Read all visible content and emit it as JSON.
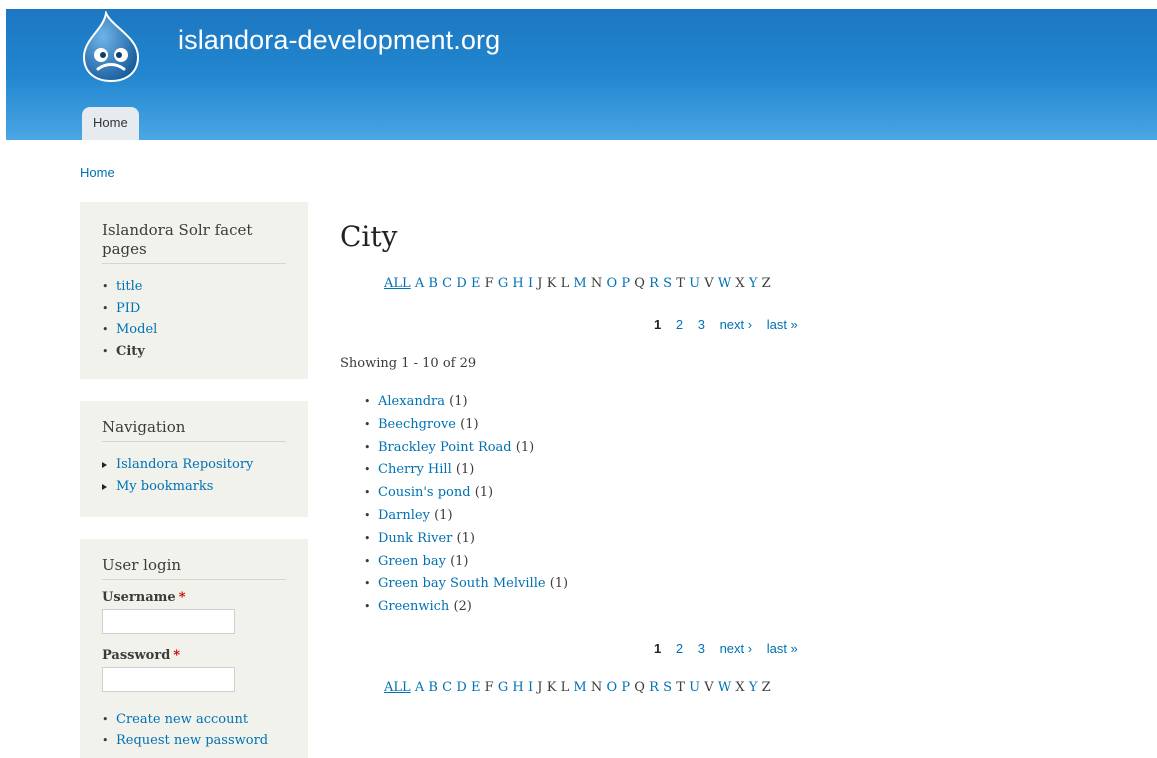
{
  "header": {
    "site_name": "islandora-development.org",
    "menu": [
      {
        "label": "Home"
      }
    ]
  },
  "breadcrumb": {
    "home": "Home"
  },
  "sidebar": {
    "facets": {
      "title": "Islandora Solr facet pages",
      "items": [
        {
          "label": "title"
        },
        {
          "label": "PID"
        },
        {
          "label": "Model"
        },
        {
          "label": "City"
        }
      ]
    },
    "navigation": {
      "title": "Navigation",
      "items": [
        {
          "label": "Islandora Repository"
        },
        {
          "label": "My bookmarks"
        }
      ]
    },
    "login": {
      "title": "User login",
      "username_label": "Username",
      "password_label": "Password",
      "required_mark": "*",
      "links": [
        {
          "label": "Create new account"
        },
        {
          "label": "Request new password"
        }
      ]
    }
  },
  "main": {
    "title": "City",
    "alphabet": [
      {
        "label": "ALL",
        "link": true
      },
      {
        "label": "A",
        "link": true
      },
      {
        "label": "B",
        "link": true
      },
      {
        "label": "C",
        "link": true
      },
      {
        "label": "D",
        "link": true
      },
      {
        "label": "E",
        "link": true
      },
      {
        "label": "F",
        "link": false
      },
      {
        "label": "G",
        "link": true
      },
      {
        "label": "H",
        "link": true
      },
      {
        "label": "I",
        "link": true
      },
      {
        "label": "J",
        "link": false
      },
      {
        "label": "K",
        "link": false
      },
      {
        "label": "L",
        "link": false
      },
      {
        "label": "M",
        "link": true
      },
      {
        "label": "N",
        "link": false
      },
      {
        "label": "O",
        "link": true
      },
      {
        "label": "P",
        "link": true
      },
      {
        "label": "Q",
        "link": false
      },
      {
        "label": "R",
        "link": true
      },
      {
        "label": "S",
        "link": true
      },
      {
        "label": "T",
        "link": false
      },
      {
        "label": "U",
        "link": true
      },
      {
        "label": "V",
        "link": false
      },
      {
        "label": "W",
        "link": true
      },
      {
        "label": "X",
        "link": false
      },
      {
        "label": "Y",
        "link": true
      },
      {
        "label": "Z",
        "link": false
      }
    ],
    "pager": {
      "pages": [
        "1",
        "2",
        "3"
      ],
      "current": "1",
      "next": "next ›",
      "last": "last »"
    },
    "showing": "Showing 1 - 10 of 29",
    "results": [
      {
        "name": "Alexandra",
        "count": "(1)"
      },
      {
        "name": "Beechgrove",
        "count": "(1)"
      },
      {
        "name": "Brackley Point Road",
        "count": "(1)"
      },
      {
        "name": "Cherry Hill",
        "count": "(1)"
      },
      {
        "name": "Cousin's pond",
        "count": "(1)"
      },
      {
        "name": "Darnley",
        "count": "(1)"
      },
      {
        "name": "Dunk River",
        "count": "(1)"
      },
      {
        "name": "Green bay",
        "count": "(1)"
      },
      {
        "name": "Green bay South Melville",
        "count": "(1)"
      },
      {
        "name": "Greenwich",
        "count": "(2)"
      }
    ]
  },
  "colors": {
    "header_top": "#1c77c2",
    "header_bottom": "#4aa6e4",
    "link": "#0071b3",
    "sidebar_bg": "#f2f2ed"
  },
  "icons": {
    "logo": "drupal-drop-logo"
  }
}
